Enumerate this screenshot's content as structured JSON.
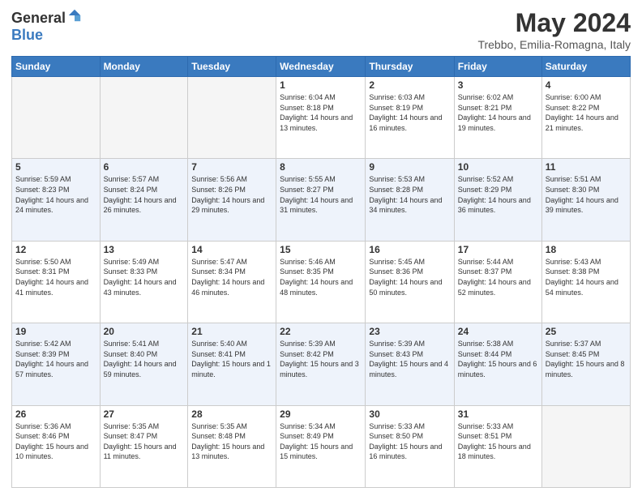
{
  "logo": {
    "general": "General",
    "blue": "Blue"
  },
  "title": "May 2024",
  "subtitle": "Trebbo, Emilia-Romagna, Italy",
  "days_of_week": [
    "Sunday",
    "Monday",
    "Tuesday",
    "Wednesday",
    "Thursday",
    "Friday",
    "Saturday"
  ],
  "weeks": [
    [
      {
        "day": "",
        "sunrise": "",
        "sunset": "",
        "daylight": ""
      },
      {
        "day": "",
        "sunrise": "",
        "sunset": "",
        "daylight": ""
      },
      {
        "day": "",
        "sunrise": "",
        "sunset": "",
        "daylight": ""
      },
      {
        "day": "1",
        "sunrise": "Sunrise: 6:04 AM",
        "sunset": "Sunset: 8:18 PM",
        "daylight": "Daylight: 14 hours and 13 minutes."
      },
      {
        "day": "2",
        "sunrise": "Sunrise: 6:03 AM",
        "sunset": "Sunset: 8:19 PM",
        "daylight": "Daylight: 14 hours and 16 minutes."
      },
      {
        "day": "3",
        "sunrise": "Sunrise: 6:02 AM",
        "sunset": "Sunset: 8:21 PM",
        "daylight": "Daylight: 14 hours and 19 minutes."
      },
      {
        "day": "4",
        "sunrise": "Sunrise: 6:00 AM",
        "sunset": "Sunset: 8:22 PM",
        "daylight": "Daylight: 14 hours and 21 minutes."
      }
    ],
    [
      {
        "day": "5",
        "sunrise": "Sunrise: 5:59 AM",
        "sunset": "Sunset: 8:23 PM",
        "daylight": "Daylight: 14 hours and 24 minutes."
      },
      {
        "day": "6",
        "sunrise": "Sunrise: 5:57 AM",
        "sunset": "Sunset: 8:24 PM",
        "daylight": "Daylight: 14 hours and 26 minutes."
      },
      {
        "day": "7",
        "sunrise": "Sunrise: 5:56 AM",
        "sunset": "Sunset: 8:26 PM",
        "daylight": "Daylight: 14 hours and 29 minutes."
      },
      {
        "day": "8",
        "sunrise": "Sunrise: 5:55 AM",
        "sunset": "Sunset: 8:27 PM",
        "daylight": "Daylight: 14 hours and 31 minutes."
      },
      {
        "day": "9",
        "sunrise": "Sunrise: 5:53 AM",
        "sunset": "Sunset: 8:28 PM",
        "daylight": "Daylight: 14 hours and 34 minutes."
      },
      {
        "day": "10",
        "sunrise": "Sunrise: 5:52 AM",
        "sunset": "Sunset: 8:29 PM",
        "daylight": "Daylight: 14 hours and 36 minutes."
      },
      {
        "day": "11",
        "sunrise": "Sunrise: 5:51 AM",
        "sunset": "Sunset: 8:30 PM",
        "daylight": "Daylight: 14 hours and 39 minutes."
      }
    ],
    [
      {
        "day": "12",
        "sunrise": "Sunrise: 5:50 AM",
        "sunset": "Sunset: 8:31 PM",
        "daylight": "Daylight: 14 hours and 41 minutes."
      },
      {
        "day": "13",
        "sunrise": "Sunrise: 5:49 AM",
        "sunset": "Sunset: 8:33 PM",
        "daylight": "Daylight: 14 hours and 43 minutes."
      },
      {
        "day": "14",
        "sunrise": "Sunrise: 5:47 AM",
        "sunset": "Sunset: 8:34 PM",
        "daylight": "Daylight: 14 hours and 46 minutes."
      },
      {
        "day": "15",
        "sunrise": "Sunrise: 5:46 AM",
        "sunset": "Sunset: 8:35 PM",
        "daylight": "Daylight: 14 hours and 48 minutes."
      },
      {
        "day": "16",
        "sunrise": "Sunrise: 5:45 AM",
        "sunset": "Sunset: 8:36 PM",
        "daylight": "Daylight: 14 hours and 50 minutes."
      },
      {
        "day": "17",
        "sunrise": "Sunrise: 5:44 AM",
        "sunset": "Sunset: 8:37 PM",
        "daylight": "Daylight: 14 hours and 52 minutes."
      },
      {
        "day": "18",
        "sunrise": "Sunrise: 5:43 AM",
        "sunset": "Sunset: 8:38 PM",
        "daylight": "Daylight: 14 hours and 54 minutes."
      }
    ],
    [
      {
        "day": "19",
        "sunrise": "Sunrise: 5:42 AM",
        "sunset": "Sunset: 8:39 PM",
        "daylight": "Daylight: 14 hours and 57 minutes."
      },
      {
        "day": "20",
        "sunrise": "Sunrise: 5:41 AM",
        "sunset": "Sunset: 8:40 PM",
        "daylight": "Daylight: 14 hours and 59 minutes."
      },
      {
        "day": "21",
        "sunrise": "Sunrise: 5:40 AM",
        "sunset": "Sunset: 8:41 PM",
        "daylight": "Daylight: 15 hours and 1 minute."
      },
      {
        "day": "22",
        "sunrise": "Sunrise: 5:39 AM",
        "sunset": "Sunset: 8:42 PM",
        "daylight": "Daylight: 15 hours and 3 minutes."
      },
      {
        "day": "23",
        "sunrise": "Sunrise: 5:39 AM",
        "sunset": "Sunset: 8:43 PM",
        "daylight": "Daylight: 15 hours and 4 minutes."
      },
      {
        "day": "24",
        "sunrise": "Sunrise: 5:38 AM",
        "sunset": "Sunset: 8:44 PM",
        "daylight": "Daylight: 15 hours and 6 minutes."
      },
      {
        "day": "25",
        "sunrise": "Sunrise: 5:37 AM",
        "sunset": "Sunset: 8:45 PM",
        "daylight": "Daylight: 15 hours and 8 minutes."
      }
    ],
    [
      {
        "day": "26",
        "sunrise": "Sunrise: 5:36 AM",
        "sunset": "Sunset: 8:46 PM",
        "daylight": "Daylight: 15 hours and 10 minutes."
      },
      {
        "day": "27",
        "sunrise": "Sunrise: 5:35 AM",
        "sunset": "Sunset: 8:47 PM",
        "daylight": "Daylight: 15 hours and 11 minutes."
      },
      {
        "day": "28",
        "sunrise": "Sunrise: 5:35 AM",
        "sunset": "Sunset: 8:48 PM",
        "daylight": "Daylight: 15 hours and 13 minutes."
      },
      {
        "day": "29",
        "sunrise": "Sunrise: 5:34 AM",
        "sunset": "Sunset: 8:49 PM",
        "daylight": "Daylight: 15 hours and 15 minutes."
      },
      {
        "day": "30",
        "sunrise": "Sunrise: 5:33 AM",
        "sunset": "Sunset: 8:50 PM",
        "daylight": "Daylight: 15 hours and 16 minutes."
      },
      {
        "day": "31",
        "sunrise": "Sunrise: 5:33 AM",
        "sunset": "Sunset: 8:51 PM",
        "daylight": "Daylight: 15 hours and 18 minutes."
      },
      {
        "day": "",
        "sunrise": "",
        "sunset": "",
        "daylight": ""
      }
    ]
  ]
}
